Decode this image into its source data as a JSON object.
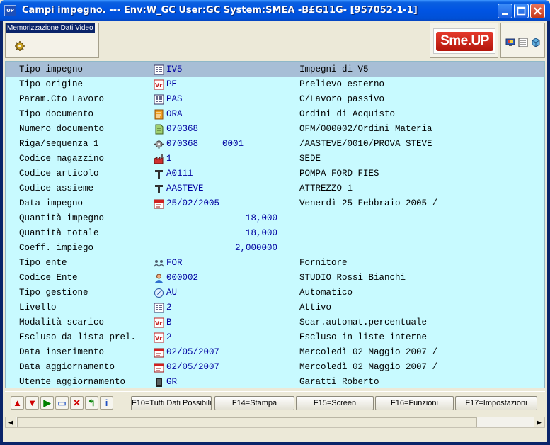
{
  "window": {
    "app_icon": "UP",
    "title": "Campi impegno. --- Env:W_GC User:GC System:SMEA -B£G11G- [957052-1-1]"
  },
  "header": {
    "memo_title": "Memorizzazione Dati Video",
    "logo_text": "Sme.UP"
  },
  "fields": [
    {
      "label": "Tipo impegno",
      "icon": "grid-icon",
      "value": "IV5",
      "desc": "Impegni di V5",
      "selected": true
    },
    {
      "label": "Tipo origine",
      "icon": "vr-icon",
      "value": "PE",
      "desc": "Prelievo esterno"
    },
    {
      "label": "Param.Cto Lavoro",
      "icon": "grid-icon",
      "value": "PAS",
      "desc": "C/Lavoro passivo"
    },
    {
      "label": "Tipo documento",
      "icon": "document-type-icon",
      "value": "ORA",
      "desc": "Ordini di Acquisto"
    },
    {
      "label": "Numero documento",
      "icon": "document-icon",
      "value": "070368",
      "desc": "OFM/000002/Ordini Materia"
    },
    {
      "label": "Riga/sequenza 1",
      "icon": "gear-icon",
      "value": "070368",
      "value2": "0001",
      "desc": "/AASTEVE/0010/PROVA STEVE"
    },
    {
      "label": "Codice magazzino",
      "icon": "factory-icon",
      "value": "1",
      "desc": "SEDE"
    },
    {
      "label": "Codice articolo",
      "icon": "tool-icon",
      "value": "A0111",
      "desc": "POMPA FORD FIES"
    },
    {
      "label": "Codice assieme",
      "icon": "tool-icon",
      "value": "AASTEVE",
      "desc": "ATTREZZO 1"
    },
    {
      "label": "Data impegno",
      "icon": "calendar-icon",
      "value": "25/02/2005",
      "desc": "Venerdì 25 Febbraio 2005 /"
    },
    {
      "label": "Quantità impegno",
      "number": "18,000"
    },
    {
      "label": "Quantità totale",
      "number": "18,000"
    },
    {
      "label": "Coeff. impiego",
      "number": "2,000000"
    },
    {
      "label": "Tipo ente",
      "icon": "people-icon",
      "value": "FOR",
      "desc": "Fornitore"
    },
    {
      "label": "Codice Ente",
      "icon": "user-icon",
      "value": "000002",
      "desc": "STUDIO Rossi Bianchi"
    },
    {
      "label": "Tipo gestione",
      "icon": "compass-icon",
      "value": "AU",
      "desc": "Automatico"
    },
    {
      "label": "Livello",
      "icon": "grid-icon",
      "value": "2",
      "desc": "Attivo"
    },
    {
      "label": "Modalità scarico",
      "icon": "vr-icon",
      "value": "B",
      "desc": "Scar.automat.percentuale"
    },
    {
      "label": "Escluso da lista prel.",
      "icon": "vr-icon",
      "value": "2",
      "desc": "Escluso in liste interne"
    },
    {
      "label": "Data inserimento",
      "icon": "calendar-icon",
      "value": "02/05/2007",
      "desc": "Mercoledì 02 Maggio 2007 /"
    },
    {
      "label": "Data aggiornamento",
      "icon": "calendar-icon",
      "value": "02/05/2007",
      "desc": "Mercoledì 02 Maggio 2007 /"
    },
    {
      "label": "Utente aggiornamento",
      "icon": "terminal-icon",
      "value": "GR",
      "desc": "Garatti Roberto"
    }
  ],
  "actions": [
    {
      "name": "arrow-up-icon",
      "glyph": "▲",
      "color": "#D00000"
    },
    {
      "name": "arrow-down-icon",
      "glyph": "▼",
      "color": "#D00000"
    },
    {
      "name": "play-icon",
      "glyph": "▶",
      "color": "#008000"
    },
    {
      "name": "eraser-icon",
      "glyph": "▭",
      "color": "#2050C0"
    },
    {
      "name": "delete-icon",
      "glyph": "✕",
      "color": "#D00000"
    },
    {
      "name": "back-arrow-icon",
      "glyph": "↰",
      "color": "#008000"
    },
    {
      "name": "info-icon",
      "glyph": "i",
      "color": "#2050C0"
    }
  ],
  "function_keys": [
    {
      "label": "F10=Tutti Dati Possibili"
    },
    {
      "label": "F14=Stampa"
    },
    {
      "label": "F15=Screen"
    },
    {
      "label": "F16=Funzioni"
    },
    {
      "label": "F17=Impostazioni"
    }
  ],
  "colors": {
    "data_background": "#C8FAFF",
    "selected_row": "#A7BED6",
    "value_text": "#0000A0",
    "title_bar": "#0054E3"
  }
}
